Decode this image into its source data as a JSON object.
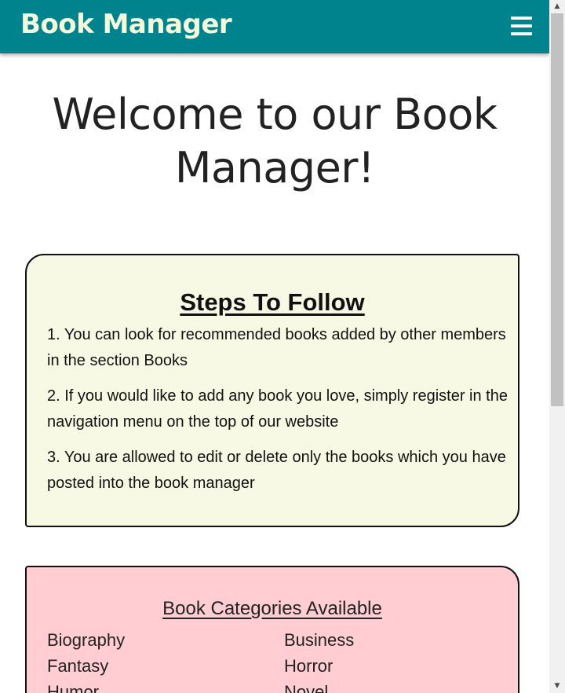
{
  "navbar": {
    "brand": "Book Manager",
    "menu_icon": "hamburger-menu-icon",
    "background_color": "#00838c",
    "brand_color": "#f5f9dc"
  },
  "main": {
    "welcome_heading": "Welcome to our Book Manager!"
  },
  "steps": {
    "title": "Steps To Follow",
    "background_color": "#f8f9e4",
    "items": [
      "1. You can look for recommended books added by other members in the section Books",
      "2. If you would like to add any book you love, simply register in the navigation menu on the top of our website",
      "3. You are allowed to edit or delete only the books which you have posted into the book manager"
    ]
  },
  "categories": {
    "title": "Book Categories Available",
    "background_color": "#ffcdd2",
    "items": [
      "Biography",
      "Business",
      "Fantasy",
      "Horror",
      "Humor",
      "Novel"
    ]
  },
  "scrollbar": {
    "up_icon": "scroll-up-arrow-icon",
    "down_icon": "scroll-down-arrow-icon"
  }
}
